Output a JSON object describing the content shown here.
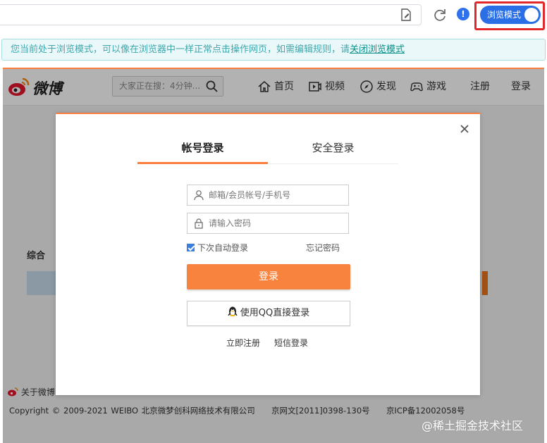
{
  "browser": {
    "browse_mode_label": "浏览模式",
    "notice_text": "您当前处于浏览模式，可以像在浏览器中一样正常点击操作网页，如需编辑规则，请",
    "notice_link": "关闭浏览模式"
  },
  "header": {
    "logo_text": "微博",
    "search_placeholder": "大家正在搜：4分钟...",
    "nav": [
      "首页",
      "视频",
      "发现",
      "游戏"
    ],
    "register": "注册",
    "login": "登录"
  },
  "background": {
    "section_label": "综合",
    "about": "关于微博",
    "copyright": "Copyright © 2009-2021 WEIBO 北京微梦创科网络技术有限公司",
    "license1": "京网文[2011]0398-130号",
    "license2": "京ICP备12002058号"
  },
  "modal": {
    "tab_account": "帐号登录",
    "tab_secure": "安全登录",
    "username_placeholder": "邮箱/会员帐号/手机号",
    "password_placeholder": "请输入密码",
    "remember": "下次自动登录",
    "forgot": "忘记密码",
    "login_button": "登录",
    "qq_button": "使用QQ直接登录",
    "register_link": "立即注册",
    "sms_link": "短信登录"
  },
  "watermark": "@稀土掘金技术社区",
  "colors": {
    "accent_orange": "#fa7d3c",
    "toggle_blue": "#2b6fe6",
    "highlight_red": "#e3262a",
    "notice_teal": "#3fa7ad"
  }
}
